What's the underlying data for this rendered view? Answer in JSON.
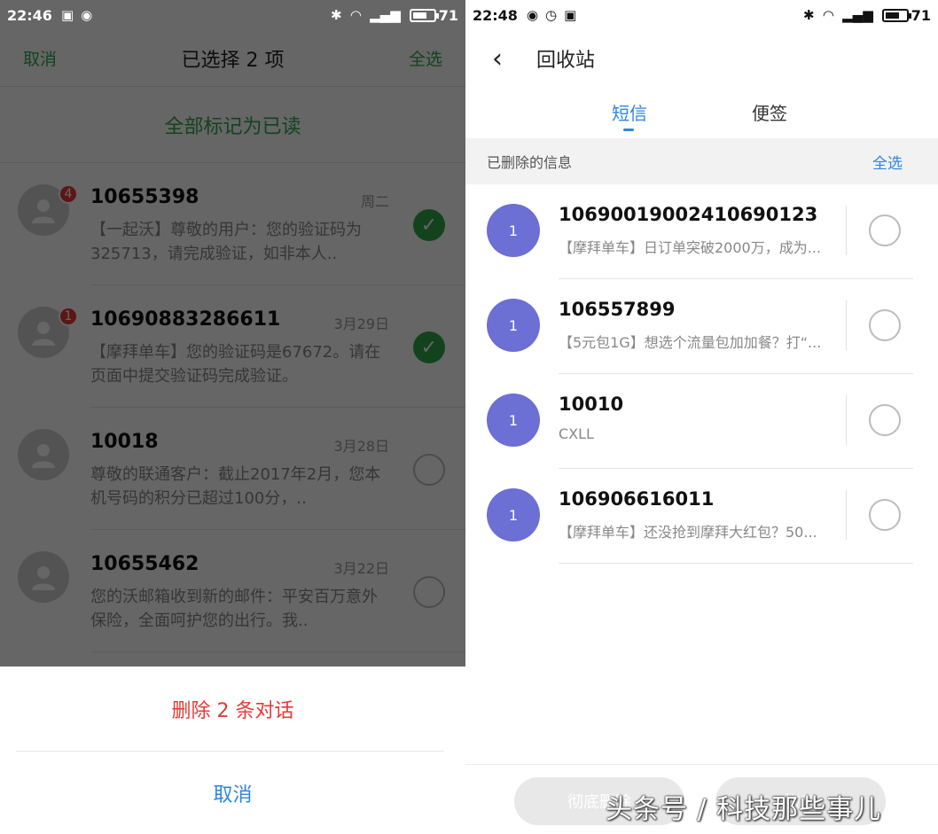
{
  "left": {
    "status": {
      "time": "22:46",
      "battery": "71"
    },
    "select_bar": {
      "cancel": "取消",
      "title": "已选择 2 项",
      "select_all": "全选"
    },
    "mark_read": "全部标记为已读",
    "conversations": [
      {
        "number": "10655398",
        "date": "周二",
        "badge": "4",
        "snippet": "【一起沃】尊敬的用户：您的验证码为325713，请完成验证，如非本人..",
        "checked": true
      },
      {
        "number": "10690883286611",
        "date": "3月29日",
        "badge": "1",
        "snippet": "【摩拜单车】您的验证码是67672。请在页面中提交验证码完成验证。",
        "checked": true
      },
      {
        "number": "10018",
        "date": "3月28日",
        "badge": "",
        "snippet": "尊敬的联通客户：截止2017年2月，您本机号码的积分已超过100分，..",
        "checked": false
      },
      {
        "number": "10655462",
        "date": "3月22日",
        "badge": "",
        "snippet": "您的沃邮箱收到新的邮件：平安百万意外保险，全面呵护您的出行。我..",
        "checked": false
      }
    ],
    "sheet": {
      "delete": "删除 2 条对话",
      "cancel": "取消"
    }
  },
  "right": {
    "status": {
      "time": "22:48",
      "battery": "71"
    },
    "title": "回收站",
    "tabs": [
      {
        "label": "短信",
        "active": true
      },
      {
        "label": "便签",
        "active": false
      }
    ],
    "section": {
      "label": "已删除的信息",
      "select_all": "全选"
    },
    "messages": [
      {
        "count": "1",
        "number": "10690019002410690123",
        "snippet": "【摩拜单车】日订单突破2000万，成为..."
      },
      {
        "count": "1",
        "number": "106557899",
        "snippet": "【5元包1G】想选个流量包加加餐？打“..."
      },
      {
        "count": "1",
        "number": "10010",
        "snippet": "CXLL"
      },
      {
        "count": "1",
        "number": "106906616011",
        "snippet": "【摩拜单车】还没抢到摩拜大红包？50..."
      }
    ],
    "buttons": {
      "delete_forever": "彻底删除",
      "restore": "恢复"
    }
  },
  "watermark": "头条号 / 科技那些事儿",
  "colors": {
    "green": "#2da84a",
    "blue": "#2d86e0",
    "red": "#e53935",
    "avatar": "#6c6fd4"
  }
}
